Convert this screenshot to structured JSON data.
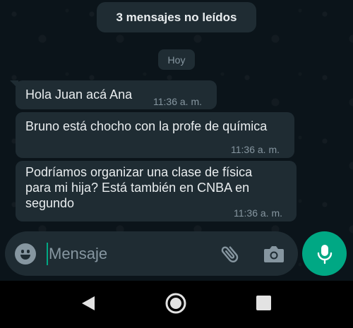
{
  "banner": {
    "unread_label": "3 mensajes no leídos"
  },
  "day_separator": "Hoy",
  "messages": [
    {
      "text": "Hola Juan acá Ana",
      "time": "11:36 a. m."
    },
    {
      "text": "Bruno está chocho con la profe de química",
      "time": "11:36 a. m."
    },
    {
      "text": "Podríamos organizar una clase de física\npara mi hija? Está también en CNBA en\nsegundo",
      "time": "11:36 a. m."
    }
  ],
  "composer": {
    "placeholder": "Mensaje",
    "icons": [
      "emoji-icon",
      "paperclip-icon",
      "camera-icon"
    ]
  },
  "mic_icon": "microphone-icon",
  "navigation": [
    "back-triangle-icon",
    "home-circle-icon",
    "recents-square-icon"
  ],
  "colors": {
    "background": "#0b141a",
    "bubble": "#1f2c33",
    "accent": "#00a884",
    "secondary_text": "#8696a0",
    "primary_text": "#e9edef"
  }
}
